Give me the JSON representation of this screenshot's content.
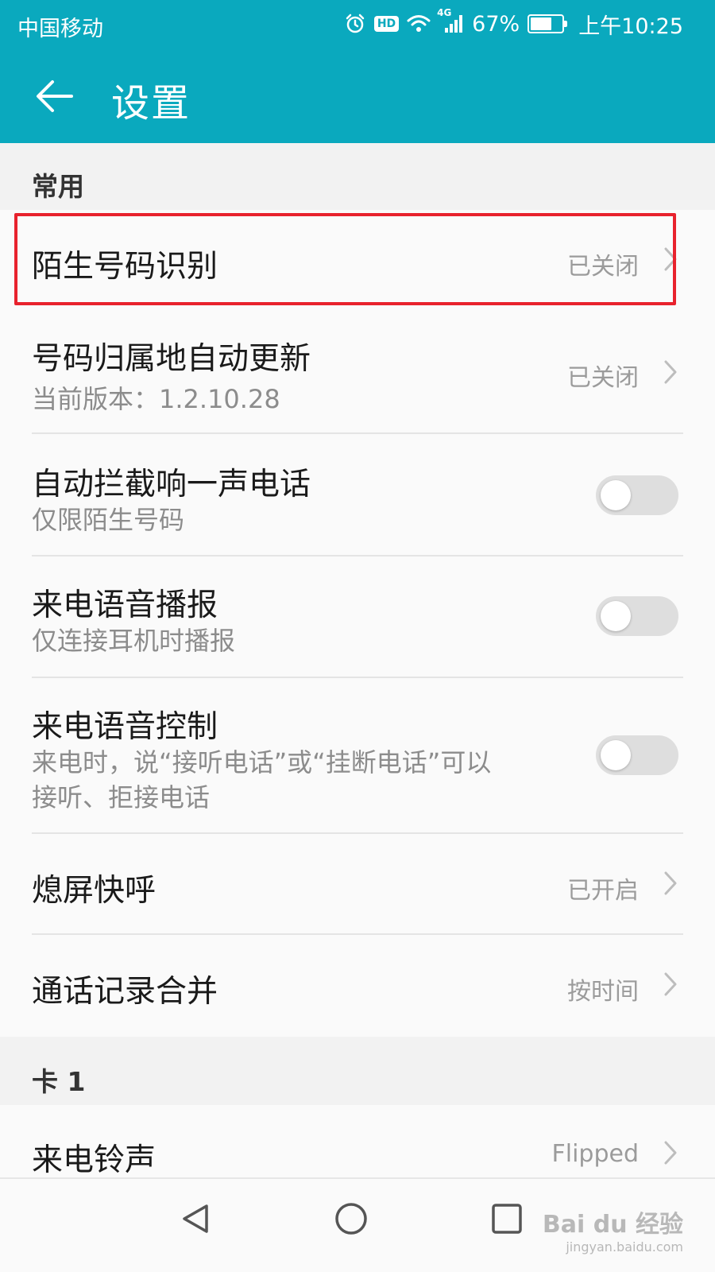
{
  "status_bar": {
    "carrier": "中国移动",
    "network_label": "4G",
    "hd_label": "HD",
    "battery_percent": "67%",
    "battery_level": 0.67,
    "time": "上午10:25"
  },
  "app_bar": {
    "title": "设置",
    "color": "#0aa9be"
  },
  "sections": {
    "common": "常用",
    "card1": "卡 1"
  },
  "rows": {
    "stranger_id": {
      "title": "陌生号码识别",
      "value": "已关闭"
    },
    "location_update": {
      "title": "号码归属地自动更新",
      "sub": "当前版本：1.2.10.28",
      "value": "已关闭"
    },
    "block_one_ring": {
      "title": "自动拦截响一声电话",
      "sub": "仅限陌生号码",
      "enabled": false
    },
    "voice_broadcast": {
      "title": "来电语音播报",
      "sub": "仅连接耳机时播报",
      "enabled": false
    },
    "voice_control": {
      "title": "来电语音控制",
      "sub_line1": "来电时，说“接听电话”或“挂断电话”可以",
      "sub_line2": "接听、拒接电话",
      "enabled": false
    },
    "screen_off_call": {
      "title": "熄屏快呼",
      "value": "已开启"
    },
    "merge_log": {
      "title": "通话记录合并",
      "value": "按时间"
    },
    "ringtone": {
      "title": "来电铃声",
      "value": "Flipped"
    }
  },
  "highlight_color": "#e8222d",
  "watermark": {
    "main": "Bai du 经验",
    "sub": "jingyan.baidu.com"
  }
}
